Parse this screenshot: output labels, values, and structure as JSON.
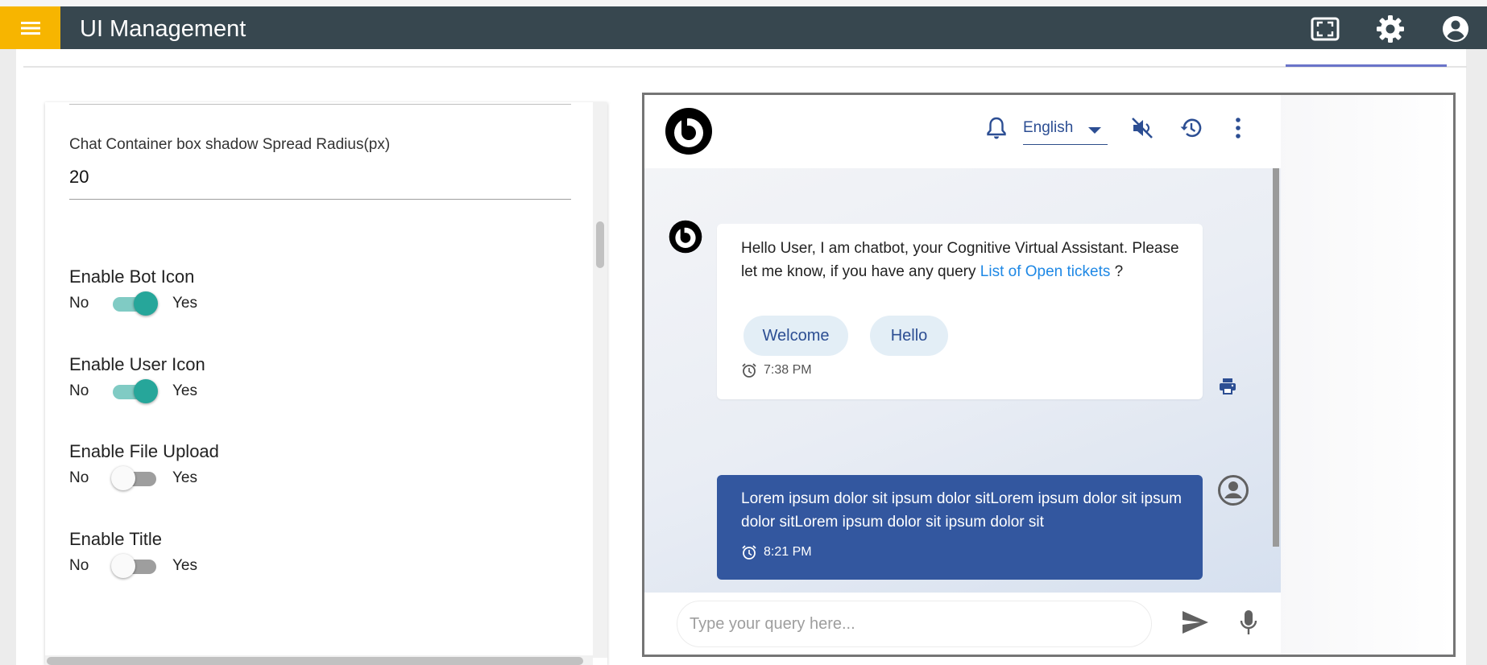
{
  "app": {
    "title": "UI Management"
  },
  "appbar_icons": [
    "menu-icon",
    "fullscreen-icon",
    "settings-gear-icon",
    "account-circle-icon"
  ],
  "settings": {
    "box_shadow_field": {
      "label": "Chat Container box shadow Spread Radius(px)",
      "value": "20"
    },
    "toggles": [
      {
        "title": "Enable Bot Icon",
        "no_label": "No",
        "yes_label": "Yes",
        "enabled": true
      },
      {
        "title": "Enable User Icon",
        "no_label": "No",
        "yes_label": "Yes",
        "enabled": true
      },
      {
        "title": "Enable File Upload",
        "no_label": "No",
        "yes_label": "Yes",
        "enabled": false
      },
      {
        "title": "Enable Title",
        "no_label": "No",
        "yes_label": "Yes",
        "enabled": false
      }
    ]
  },
  "chat": {
    "header": {
      "language": "English",
      "icons": [
        "notification-bell-icon",
        "mute-icon",
        "history-icon",
        "more-vert-icon"
      ]
    },
    "bot_message": {
      "text_before_link": "Hello User, I am chatbot, your Cognitive Virtual Assistant. Please let me know, if you have any query ",
      "link_text": "List of Open tickets",
      "text_after_link": " ?",
      "chips": [
        "Welcome",
        "Hello"
      ],
      "time": "7:38 PM"
    },
    "user_message": {
      "text": "Lorem ipsum dolor sit ipsum dolor sitLorem ipsum dolor sit ipsum dolor sitLorem ipsum dolor sit ipsum dolor sit",
      "time": "8:21 PM"
    },
    "input": {
      "placeholder": "Type your query here...",
      "value": ""
    }
  },
  "colors": {
    "appbar": "#37474f",
    "menu_button": "#f7b500",
    "toggle_on": "#26a69a",
    "user_bubble": "#33579f",
    "link": "#1e88e5",
    "chip_bg": "#e3eef6"
  }
}
